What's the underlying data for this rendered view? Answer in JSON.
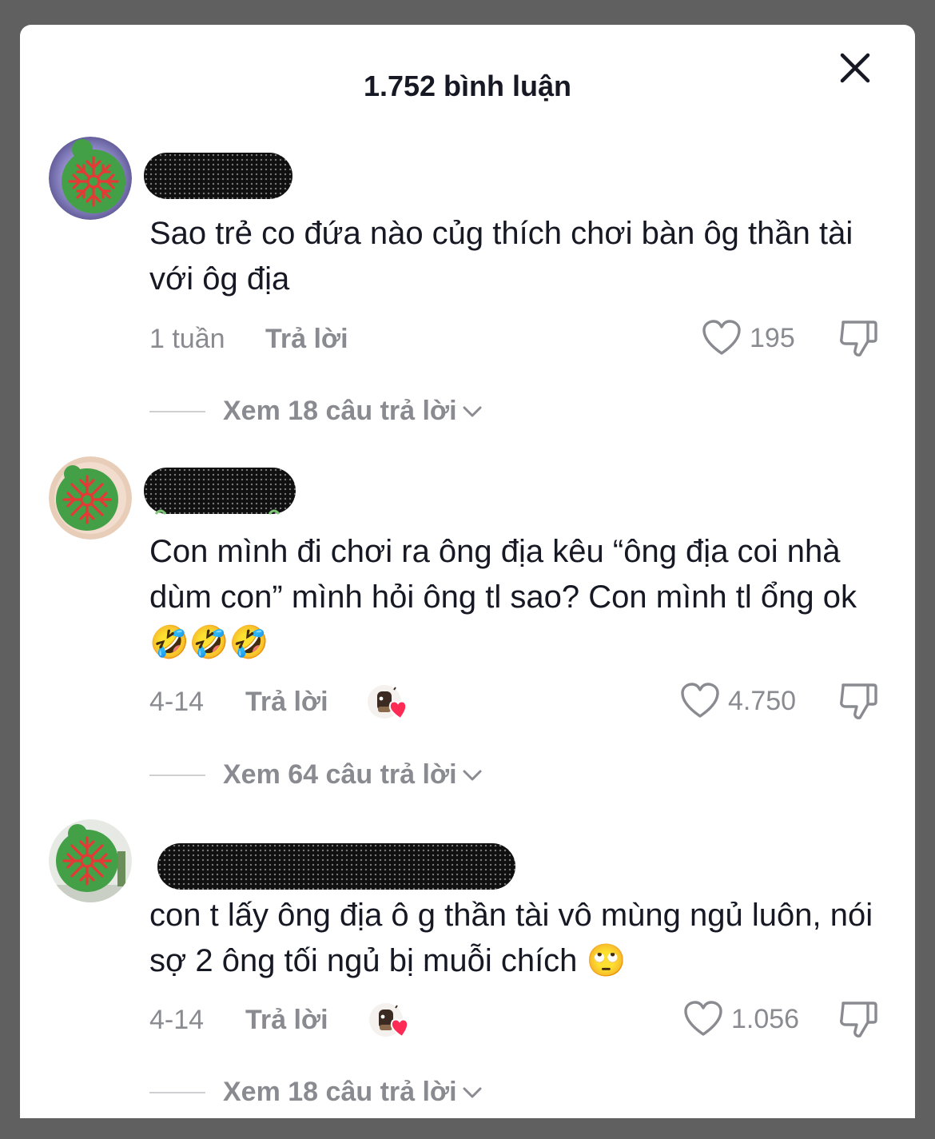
{
  "header": {
    "title": "1.752 bình luận"
  },
  "colors": {
    "text": "#161823",
    "muted": "#8a8b91",
    "accent_heart": "#fe2c55"
  },
  "comments": [
    {
      "text": "Sao trẻ co đứa nào củg thích chơi bàn ôg thần tài với ôg địa",
      "time": "1 tuần",
      "reply_label": "Trả lời",
      "likes": "195",
      "view_replies": "Xem 18 câu trả lời",
      "creator_liked": false
    },
    {
      "text": "Con mình đi chơi ra ông địa kêu “ông địa coi nhà dùm con” mình hỏi ông tl sao? Con mình tl ổng ok 🤣🤣🤣",
      "time": "4-14",
      "reply_label": "Trả lời",
      "likes": "4.750",
      "view_replies": "Xem 64 câu trả lời",
      "creator_liked": true
    },
    {
      "text": "con t lấy ông địa ô g thần tài vô mùng ngủ luôn, nói sợ 2 ông tối ngủ bị muỗi chích 🙄",
      "time": "4-14",
      "reply_label": "Trả lời",
      "likes": "1.056",
      "view_replies": "Xem 18 câu trả lời",
      "creator_liked": true
    }
  ]
}
